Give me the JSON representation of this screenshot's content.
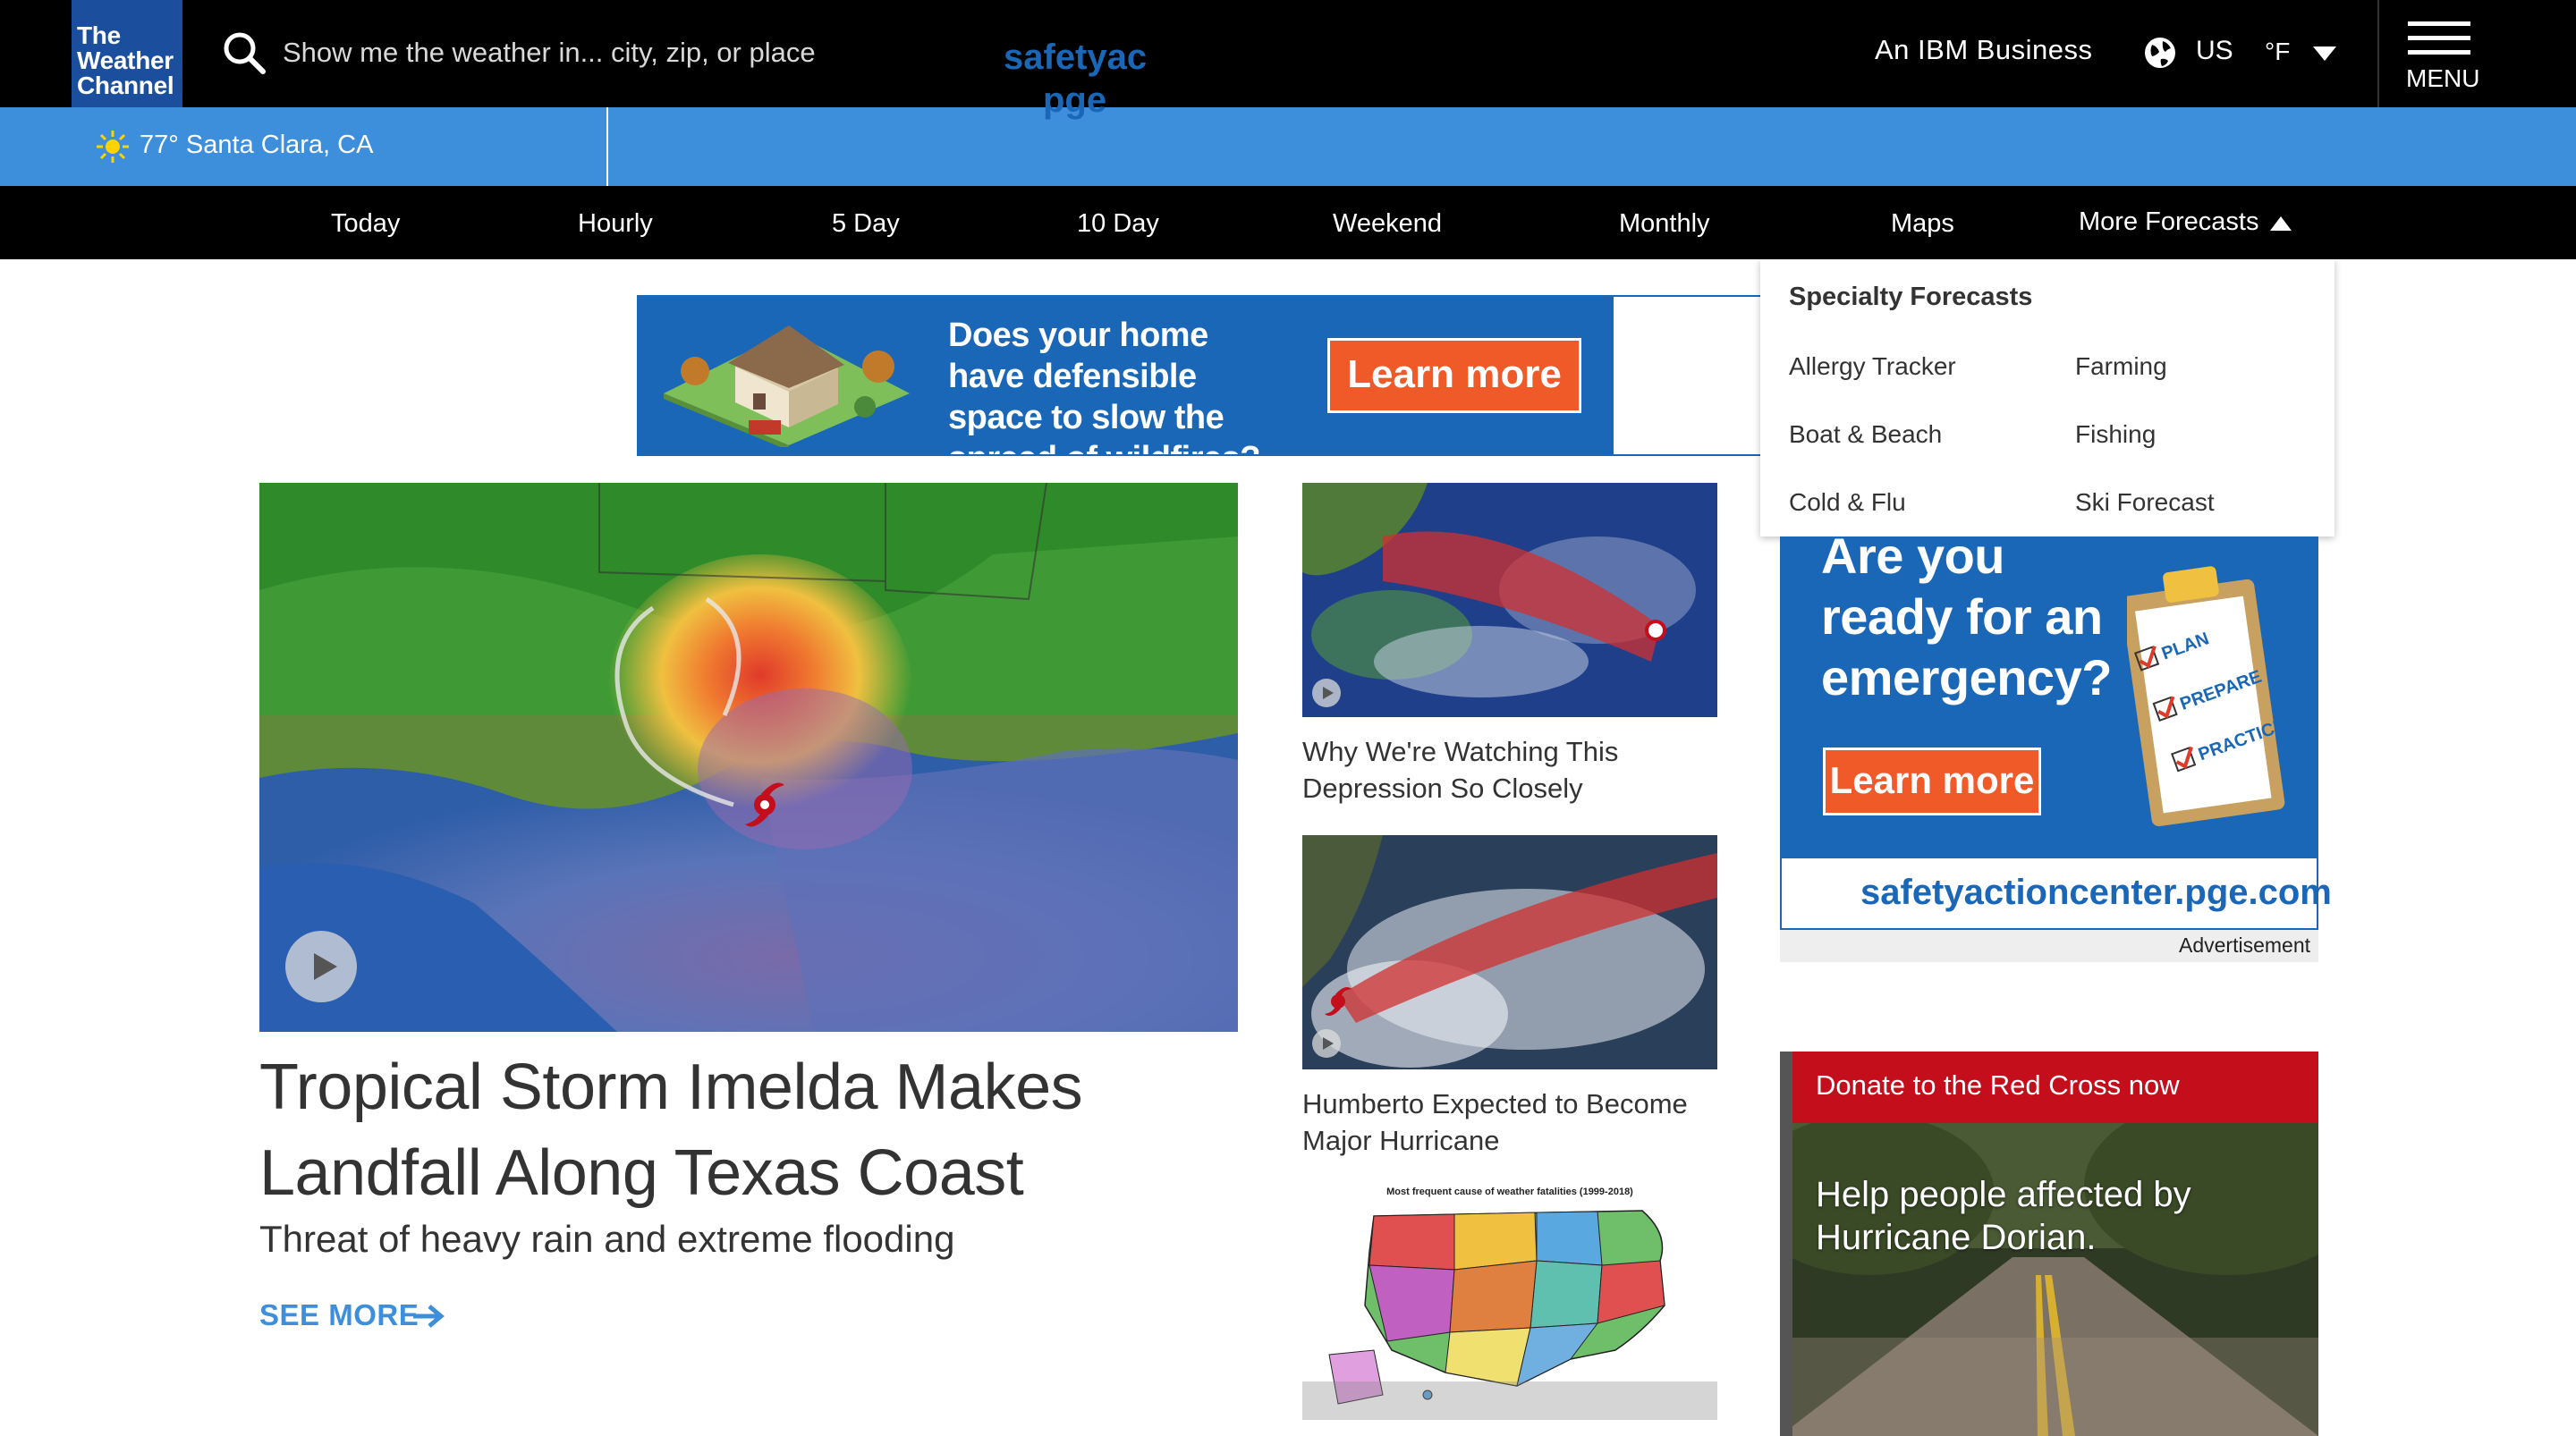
{
  "header": {
    "logo_line1": "The",
    "logo_line2": "Weather",
    "logo_line3": "Channel",
    "search_placeholder": "Show me the weather in... city, zip, or place",
    "ibm_text": "An IBM Business",
    "locale": "US",
    "unit": "°F",
    "menu_label": "MENU"
  },
  "location_bar": {
    "text": "77° Santa Clara, CA"
  },
  "nav": {
    "items": [
      "Today",
      "Hourly",
      "5 Day",
      "10 Day",
      "Weekend",
      "Monthly",
      "Maps",
      "More Forecasts"
    ]
  },
  "top_banner": {
    "headline": "Does your home have defensible space to slow the spread of wildfires?",
    "cta": "Learn more",
    "brand_line1": "safetyac",
    "brand_line2": "pge"
  },
  "dropdown": {
    "title": "Specialty Forecasts",
    "items": [
      "Allergy Tracker",
      "Farming",
      "Boat & Beach",
      "Fishing",
      "Cold & Flu",
      "Ski Forecast"
    ]
  },
  "hero": {
    "title": "Tropical Storm Imelda Makes Landfall Along Texas Coast",
    "subtitle": "Threat of heavy rain and extreme flooding",
    "see_more": "SEE MORE"
  },
  "stories": [
    {
      "title": "Why We're Watching This Depression So Closely"
    },
    {
      "title": "Humberto Expected to Become Major Hurricane"
    },
    {
      "map_caption": "Most frequent cause of weather fatalities (1999-2018)"
    }
  ],
  "right_ad": {
    "headline": "Are you ready for an emergency?",
    "clip_items": [
      "PLAN",
      "PREPARE",
      "PRACTICE"
    ],
    "cta": "Learn more",
    "url": "safetyactioncenter.pge.com",
    "label": "Advertisement"
  },
  "red_cross": {
    "header": "Donate to the Red Cross now",
    "text": "Help people affected by Hurricane Dorian."
  },
  "colors": {
    "topbar": "#000000",
    "logo_bg": "#1b4f9e",
    "location_bar": "#3d8edb",
    "accent": "#3d8edb",
    "ad_blue": "#1b67b7",
    "ad_orange": "#f05a28",
    "red_cross": "#c40e1c"
  },
  "icons": [
    "search-icon",
    "globe-icon",
    "caret-down-icon",
    "menu-icon",
    "sun-icon",
    "caret-up-icon",
    "play-icon",
    "arrow-right-icon"
  ]
}
